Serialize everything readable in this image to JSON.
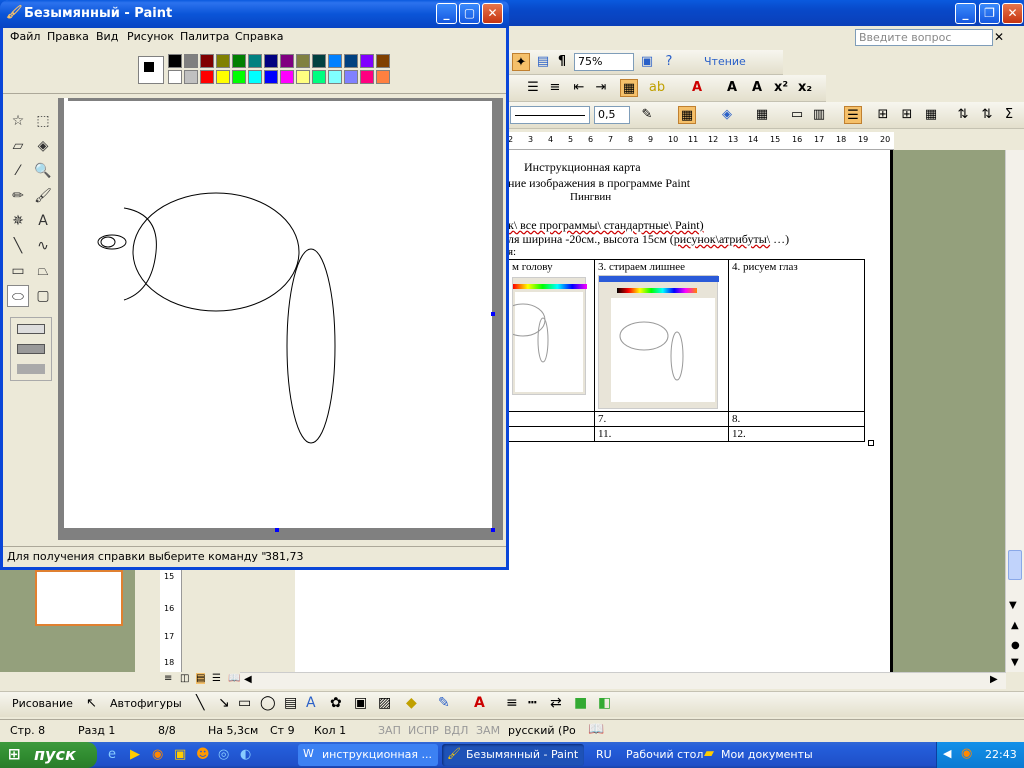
{
  "word": {
    "ask_placeholder": "Введите вопрос",
    "zoom": "75%",
    "read_button": "Чтение",
    "line_width": "0,5",
    "ruler_marks": [
      "2",
      "3",
      "4",
      "5",
      "6",
      "7",
      "8",
      "9",
      "10",
      "11",
      "12",
      "13",
      "14",
      "15",
      "16",
      "17",
      "18",
      "19",
      "20"
    ],
    "vruler_marks": [
      "15",
      "16",
      "17",
      "18"
    ],
    "doc": {
      "title1": "Инструкционная карта",
      "title2": "ние изображения в программе Paint",
      "title3": "Пингвин",
      "line1a": "к\\ все программы\\ стандартные\\ Paint)",
      "line2a": "ля ширина -20см., высота 15см (",
      "line2b": "рисунок\\атрибуты\\",
      "line2c": " …)",
      "line3": "я:",
      "cells": {
        "c2": "м голову",
        "c3": "3.  стираем лишнее",
        "c4": "4.   рисуем глаз",
        "c7": "7.",
        "c8": "8.",
        "c11": "11.",
        "c12": "12."
      }
    },
    "drawbar": {
      "draw_label": "Рисование",
      "autoshapes_label": "Автофигуры"
    },
    "status": {
      "page": "Стр.  8",
      "section": "Разд  1",
      "pages": "8/8",
      "at": "На 5,3см",
      "line": "Ст  9",
      "col": "Кол  1",
      "rec": "ЗАП",
      "trk": "ИСПР",
      "ext": "ВДЛ",
      "ovr": "ЗАМ",
      "lang": "русский (Ро"
    }
  },
  "paint": {
    "title": "Безымянный - Paint",
    "menu": [
      "Файл",
      "Правка",
      "Вид",
      "Рисунок",
      "Палитра",
      "Справка"
    ],
    "status_text": "Для получения справки выберите команду \"Вызов",
    "coords": "381,73",
    "palette_top": [
      "#000000",
      "#808080",
      "#800000",
      "#808000",
      "#008000",
      "#008080",
      "#000080",
      "#800080",
      "#808040",
      "#004040",
      "#0080ff",
      "#004080",
      "#8000ff",
      "#804000"
    ],
    "palette_bottom": [
      "#ffffff",
      "#c0c0c0",
      "#ff0000",
      "#ffff00",
      "#00ff00",
      "#00ffff",
      "#0000ff",
      "#ff00ff",
      "#ffff80",
      "#00ff80",
      "#80ffff",
      "#8080ff",
      "#ff0080",
      "#ff8040"
    ],
    "tools": [
      "free-select-icon",
      "rect-select-icon",
      "eraser-icon",
      "fill-icon",
      "picker-icon",
      "magnifier-icon",
      "pencil-icon",
      "brush-icon",
      "airbrush-icon",
      "text-icon",
      "line-icon",
      "curve-icon",
      "rectangle-icon",
      "polygon-icon",
      "ellipse-icon",
      "rounded-rect-icon"
    ]
  },
  "taskbar": {
    "start": "пуск",
    "task_word": "инструкционная ...",
    "task_paint": "Безымянный - Paint",
    "lang": "RU",
    "desktop": "Рабочий стол",
    "mydocs": "Мои документы",
    "clock": "22:43"
  }
}
